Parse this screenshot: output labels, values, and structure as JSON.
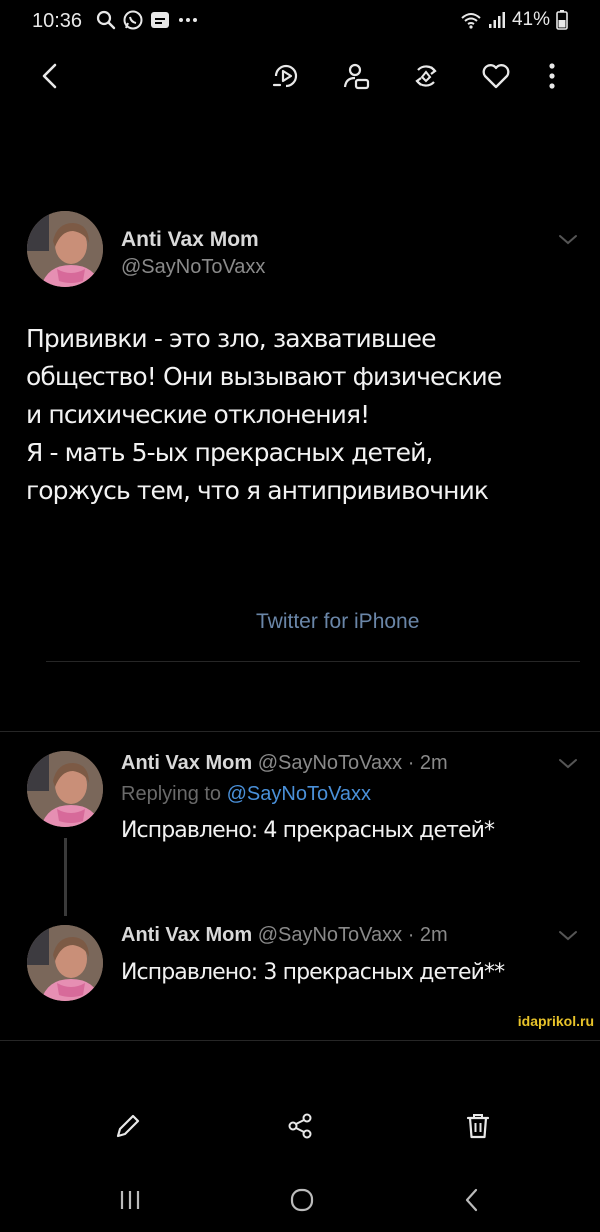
{
  "status_bar": {
    "time": "10:36",
    "notification_icons": [
      "search-icon",
      "whatsapp-icon",
      "message-icon",
      "more-notifications-icon"
    ],
    "battery": "41%",
    "system_icons": [
      "wifi-icon",
      "signal-icon",
      "battery-icon"
    ]
  },
  "toolbar": {
    "icons": [
      "back-icon",
      "enhance-icon",
      "tag-person-icon",
      "remaster-icon",
      "heart-icon",
      "more-vertical-icon"
    ]
  },
  "main_tweet": {
    "author_name": "Anti Vax Mom",
    "handle": "@SayNoToVaxx",
    "text": "Прививки - это зло, захватившее\nобщество! Они вызывают физические\nи психические отклонения!\nЯ - мать 5-ых прекрасных детей,\nгоржусь тем, что я антипрививочник",
    "source": "Twitter for iPhone"
  },
  "replies": [
    {
      "author_name": "Anti Vax Mom",
      "meta": "@SayNoToVaxx · 2m",
      "replying_prefix": "Replying to",
      "replying_to": "@SayNoToVaxx",
      "text": "Исправлено: 4 прекрасных детей*"
    },
    {
      "author_name": "Anti Vax Mom",
      "meta": "@SayNoToVaxx · 2m",
      "text": "Исправлено: 3 прекрасных детей**"
    }
  ],
  "watermark": "idaprikol.ru",
  "bottom_actions": [
    "edit-icon",
    "share-icon",
    "delete-icon"
  ],
  "nav_bar": [
    "recent-apps-icon",
    "home-icon",
    "back-icon"
  ]
}
